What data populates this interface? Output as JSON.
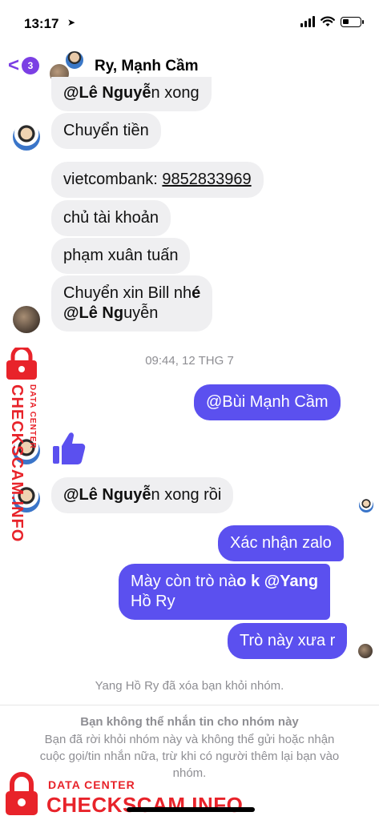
{
  "status_bar": {
    "time": "13:17",
    "battery_level": 0.35
  },
  "header": {
    "back_badge": "3",
    "title": "Ry, Mạnh Cầm"
  },
  "messages_top": [
    {
      "prefix": "@Lê Nguyễ",
      "suffix": "n xong"
    },
    {
      "text": "Chuyển tiền"
    }
  ],
  "bank": {
    "label": "vietcombank: ",
    "number": "9852833969"
  },
  "messages_mid": [
    {
      "text": "chủ tài khoản"
    },
    {
      "text": "phạm xuân tuấn"
    }
  ],
  "bill_msg": {
    "line1_a": "Chuyển xin Bill nh",
    "line1_b": "é",
    "line2_a": "@Lê Ng",
    "line2_b": "uyễn"
  },
  "timestamp": "09:44, 12 THG 7",
  "mention_out": {
    "a": "@Bùi Mạnh C",
    "b": "ầm"
  },
  "done_msg": {
    "a": "@Lê Nguyễ",
    "b": "n xong rồi"
  },
  "out_messages": [
    {
      "text": "Xác nhận zalo"
    }
  ],
  "question_msg": {
    "line1_a": "Mày còn trò nà",
    "line1_b": "o k @Yang",
    "line2": "Hồ Ry"
  },
  "last_out": {
    "text": "Trò này xưa r"
  },
  "system_note": "Yang Hồ Ry đã xóa bạn khỏi nhóm.",
  "footer": {
    "title": "Bạn không thể nhắn tin cho nhóm này",
    "body": "Bạn đã rời khỏi nhóm này và không thể gửi hoặc nhận cuộc gọi/tin nhắn nữa, trừ khi có người thêm lại bạn vào nhóm."
  },
  "watermark": {
    "small": "DATA CENTER",
    "big": "CHECKSCAM.INFO"
  },
  "colors": {
    "accent": "#7b3fe4",
    "outgoing_bubble": "#5b50ef",
    "incoming_bubble": "#efeff1",
    "watermark": "#e8232a"
  }
}
